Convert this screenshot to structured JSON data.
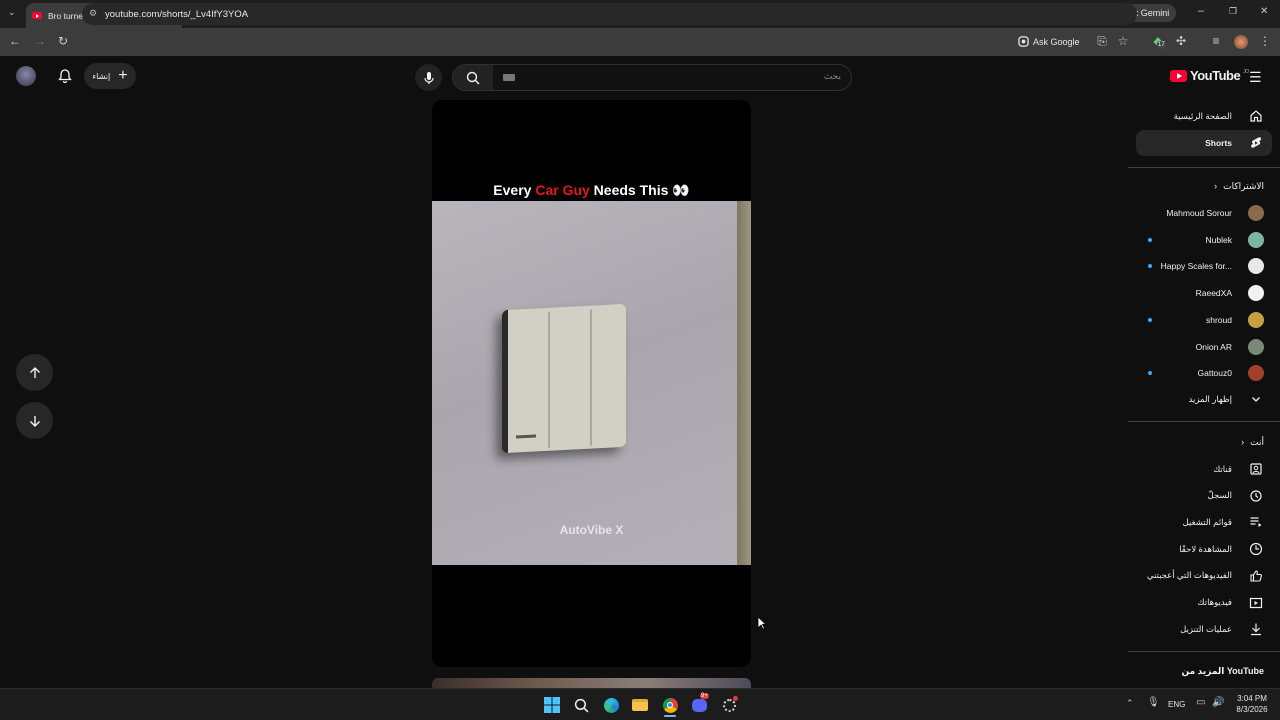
{
  "browser": {
    "tab_title": "Bro turned his room light s",
    "url": "youtube.com/shorts/_Lv4IfY3YOA",
    "ask_google": "Ask Google",
    "ask_gemini": "Ask Gemini",
    "extension_badge": "17"
  },
  "youtube": {
    "logo_text": "YouTube",
    "logo_country": "JO",
    "search_placeholder": "بحث",
    "create_label": "إنشاء",
    "video": {
      "caption_part1": "Every ",
      "caption_highlight": "Car Guy",
      "caption_part2": " Needs This 👀",
      "watermark": "AutoVibe X"
    }
  },
  "sidebar": {
    "home": "الصفحة الرئيسية",
    "shorts": "Shorts",
    "subscriptions_header": "الاشتراكات",
    "subscriptions": [
      {
        "name": "Mahmoud Sorour",
        "dot": false,
        "color": "#8a6a4a"
      },
      {
        "name": "Nublek",
        "dot": true,
        "color": "#7fb5a0"
      },
      {
        "name": "Happy Scales for...",
        "dot": true,
        "color": "#e8e8e8"
      },
      {
        "name": "RaeedXA",
        "dot": false,
        "color": "#f1f1f1"
      },
      {
        "name": "shroud",
        "dot": true,
        "color": "#c8a040"
      },
      {
        "name": "Onion AR",
        "dot": false,
        "color": "#7a8a7a"
      },
      {
        "name": "Gattouz0",
        "dot": true,
        "color": "#a0402a"
      }
    ],
    "show_more": "إظهار المزيد",
    "you_header": "أنت",
    "you_items": [
      {
        "label": "قناتك",
        "icon": "your-channel-icon"
      },
      {
        "label": "السجلّ",
        "icon": "history-icon"
      },
      {
        "label": "قوائم التشغيل",
        "icon": "playlists-icon"
      },
      {
        "label": "المشاهدة لاحقًا",
        "icon": "watch-later-icon"
      },
      {
        "label": "الفيديوهات التي أعجبتني",
        "icon": "liked-videos-icon"
      },
      {
        "label": "فيديوهاتك",
        "icon": "your-videos-icon"
      },
      {
        "label": "عمليات التنزيل",
        "icon": "downloads-icon"
      }
    ],
    "more_from_yt": "المزيد من YouTube"
  },
  "taskbar": {
    "language": "ENG",
    "time": "3:04 PM",
    "date": "8/3/2026",
    "discord_badge": "9+"
  }
}
